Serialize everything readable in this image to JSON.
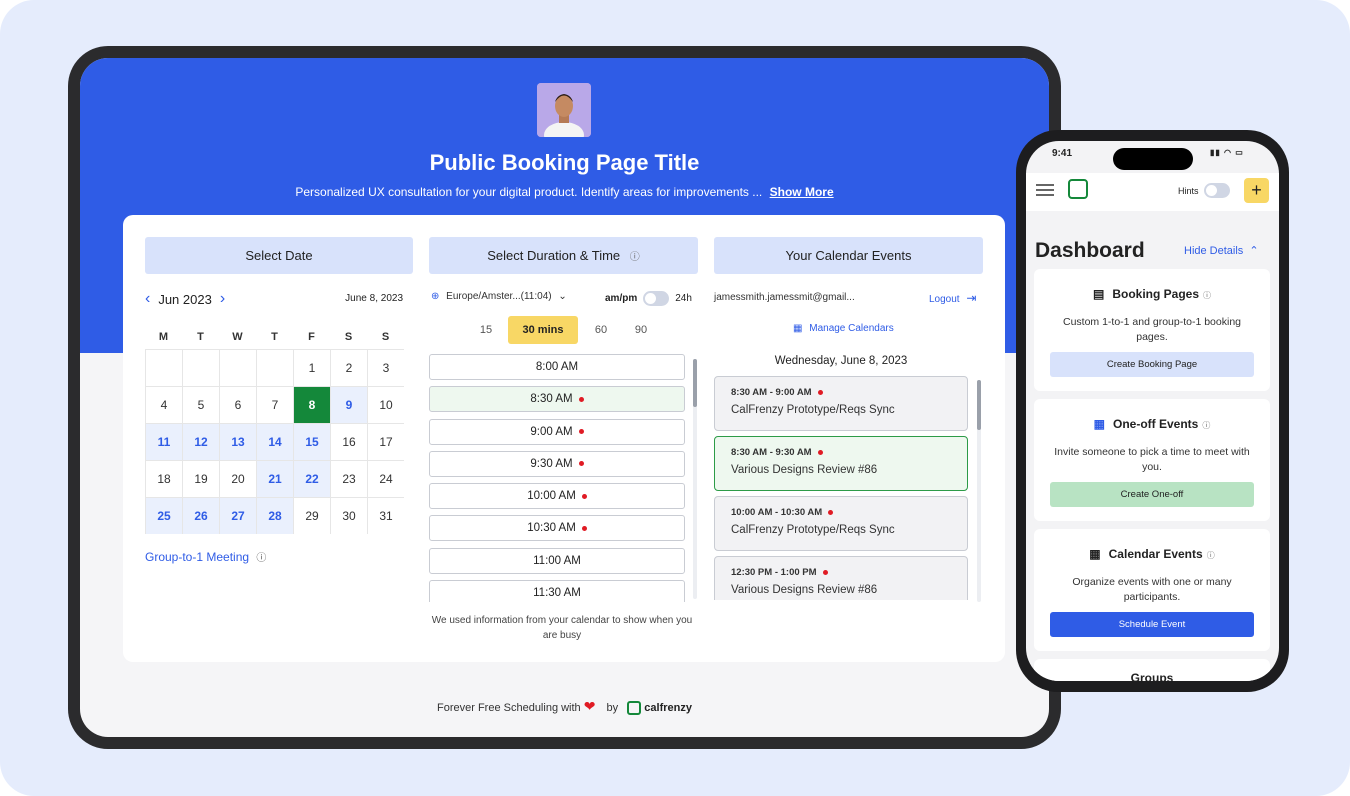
{
  "booking": {
    "title": "Public Booking Page Title",
    "description": "Personalized UX consultation for your digital product. Identify areas for improvements ...",
    "show_more": "Show More"
  },
  "columns": {
    "date": "Select Date",
    "duration": "Select Duration & Time",
    "events": "Your Calendar Events"
  },
  "calendar": {
    "month_label": "Jun 2023",
    "selected_date": "June 8, 2023",
    "weekdays": [
      "M",
      "T",
      "W",
      "T",
      "F",
      "S",
      "S"
    ],
    "days": [
      {
        "d": "",
        "s": "empty"
      },
      {
        "d": "",
        "s": "empty"
      },
      {
        "d": "",
        "s": "empty"
      },
      {
        "d": "",
        "s": "empty"
      },
      {
        "d": "1",
        "s": ""
      },
      {
        "d": "2",
        "s": ""
      },
      {
        "d": "3",
        "s": ""
      },
      {
        "d": "4",
        "s": ""
      },
      {
        "d": "5",
        "s": ""
      },
      {
        "d": "6",
        "s": ""
      },
      {
        "d": "7",
        "s": ""
      },
      {
        "d": "8",
        "s": "sel"
      },
      {
        "d": "9",
        "s": "avail"
      },
      {
        "d": "10",
        "s": ""
      },
      {
        "d": "11",
        "s": "avail"
      },
      {
        "d": "12",
        "s": "avail"
      },
      {
        "d": "13",
        "s": "avail"
      },
      {
        "d": "14",
        "s": "avail"
      },
      {
        "d": "15",
        "s": "avail"
      },
      {
        "d": "16",
        "s": ""
      },
      {
        "d": "17",
        "s": ""
      },
      {
        "d": "18",
        "s": ""
      },
      {
        "d": "19",
        "s": ""
      },
      {
        "d": "20",
        "s": ""
      },
      {
        "d": "21",
        "s": "avail"
      },
      {
        "d": "22",
        "s": "avail"
      },
      {
        "d": "23",
        "s": ""
      },
      {
        "d": "24",
        "s": ""
      },
      {
        "d": "25",
        "s": "avail"
      },
      {
        "d": "26",
        "s": "avail"
      },
      {
        "d": "27",
        "s": "avail"
      },
      {
        "d": "28",
        "s": "avail"
      },
      {
        "d": "29",
        "s": ""
      },
      {
        "d": "30",
        "s": ""
      },
      {
        "d": "31",
        "s": ""
      }
    ],
    "group_link": "Group-to-1 Meeting"
  },
  "duration": {
    "timezone": "Europe/Amster...(11:04)",
    "ampm": "am/pm",
    "h24": "24h",
    "options": [
      "15",
      "30 mins",
      "60",
      "90"
    ],
    "active": "30 mins",
    "slots": [
      {
        "time": "8:00 AM",
        "dot": false
      },
      {
        "time": "8:30 AM",
        "dot": true
      },
      {
        "time": "9:00 AM",
        "dot": true
      },
      {
        "time": "9:30 AM",
        "dot": true
      },
      {
        "time": "10:00 AM",
        "dot": true
      },
      {
        "time": "10:30 AM",
        "dot": true
      },
      {
        "time": "11:00 AM",
        "dot": false
      },
      {
        "time": "11:30 AM",
        "dot": false
      }
    ],
    "busy_note": "We used information from your calendar to show when you are busy"
  },
  "events_panel": {
    "email": "jamessmith.jamessmit@gmail...",
    "logout": "Logout",
    "manage": "Manage Calendars",
    "day_heading": "Wednesday, June 8, 2023",
    "events": [
      {
        "time": "8:30 AM - 9:00 AM",
        "name": "CalFrenzy Prototype/Reqs Sync",
        "highlight": false
      },
      {
        "time": "8:30 AM - 9:30 AM",
        "name": "Various Designs Review #86",
        "highlight": true
      },
      {
        "time": "10:00 AM - 10:30 AM",
        "name": "CalFrenzy Prototype/Reqs Sync",
        "highlight": false
      },
      {
        "time": "12:30 PM - 1:00 PM",
        "name": "Various Designs Review #86",
        "highlight": false
      }
    ]
  },
  "footer": {
    "text": "Forever Free Scheduling with",
    "by": "by",
    "brand": "calfrenzy"
  },
  "phone": {
    "time": "9:41",
    "hints": "Hints",
    "dashboard": "Dashboard",
    "hide_details": "Hide Details",
    "cards": [
      {
        "title": "Booking Pages",
        "desc": "Custom 1-to-1 and group-to-1 booking pages.",
        "button": "Create Booking Page"
      },
      {
        "title": "One-off Events",
        "desc": "Invite someone to pick a time to meet with you.",
        "button": "Create One-off"
      },
      {
        "title": "Calendar Events",
        "desc": "Organize events with one or many participants.",
        "button": "Schedule Event"
      }
    ],
    "next_card_title": "Groups"
  },
  "colors": {
    "brand_blue": "#2f5ce6",
    "selected_green": "#14883a",
    "accent_yellow": "#f8d765"
  }
}
